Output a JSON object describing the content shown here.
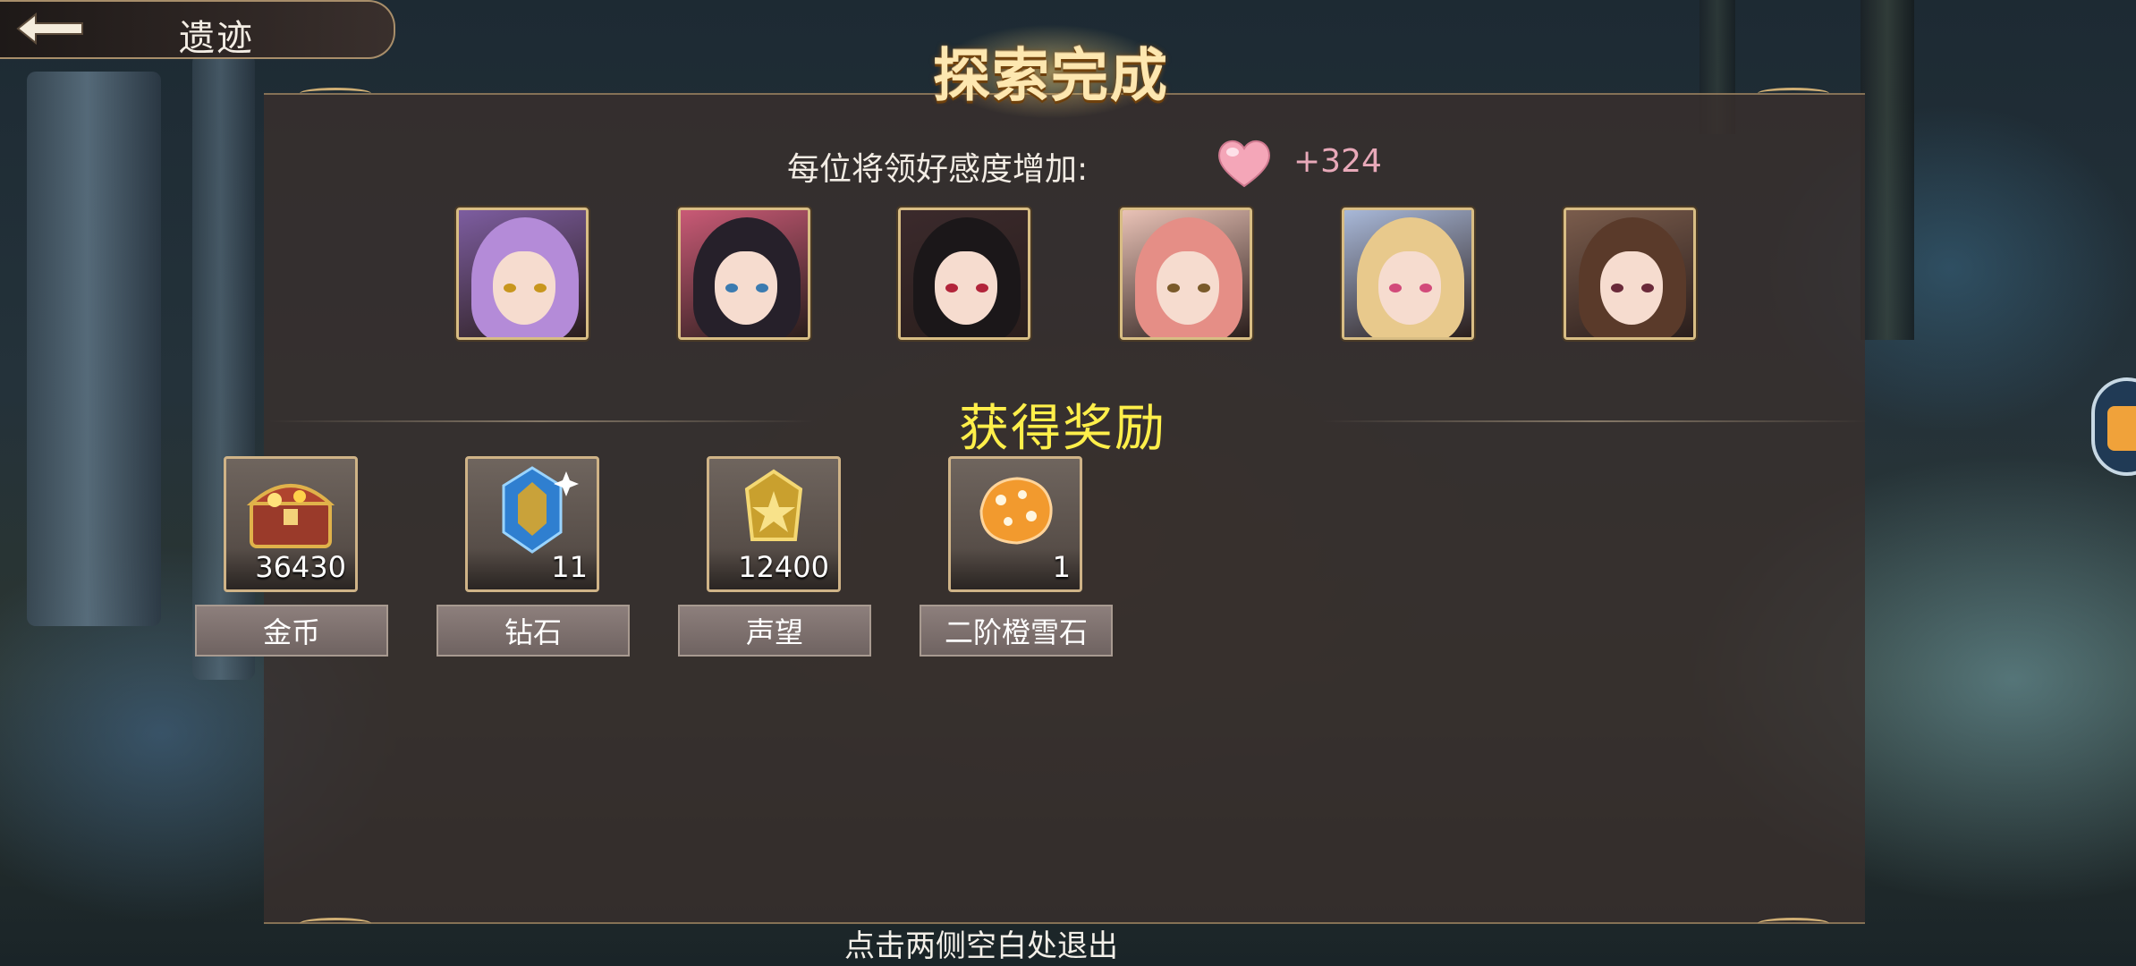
{
  "nav": {
    "title": "遗迹"
  },
  "header": {
    "title": "探索完成"
  },
  "affection": {
    "label": "每位将领好感度增加:",
    "value": "+324"
  },
  "characters": [
    {
      "hair": "#b48bd8",
      "bg": "#7d5da0",
      "eye": "#c8961e"
    },
    {
      "hair": "#26202a",
      "bg": "#c95a76",
      "eye": "#3b7bb0"
    },
    {
      "hair": "#1b1719",
      "bg": "#3b2a2c",
      "eye": "#b2243a"
    },
    {
      "hair": "#e58e86",
      "bg": "#e9c2b6",
      "eye": "#7a5a2a"
    },
    {
      "hair": "#e8c98c",
      "bg": "#a8b8d8",
      "eye": "#d24a7a"
    },
    {
      "hair": "#5a3a2a",
      "bg": "#7a5c4c",
      "eye": "#6a2a3a"
    }
  ],
  "rewards": {
    "heading": "获得奖励",
    "items": [
      {
        "name": "金币",
        "quantity": "36430",
        "icon": "treasure-chest-icon"
      },
      {
        "name": "钻石",
        "quantity": "11",
        "icon": "diamond-crystal-icon"
      },
      {
        "name": "声望",
        "quantity": "12400",
        "icon": "prestige-badge-icon"
      },
      {
        "name": "二阶橙雪石",
        "quantity": "1",
        "icon": "orange-snowstone-icon"
      }
    ]
  },
  "footer": {
    "hint": "点击两侧空白处退出"
  },
  "colors": {
    "accent_gold": "#d8bd84",
    "heading_yellow": "#ffef4a",
    "affection_pink": "#e8a9b9"
  }
}
